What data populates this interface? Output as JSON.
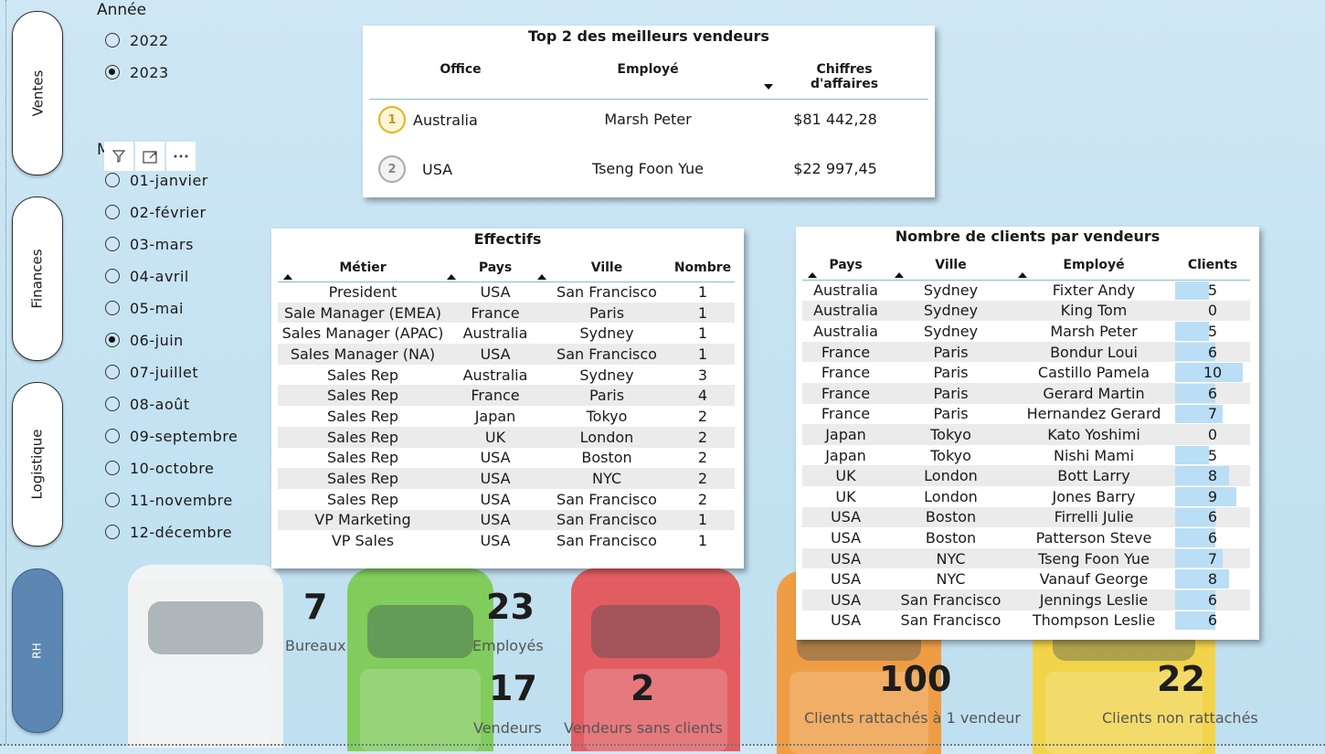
{
  "nav": {
    "items": [
      {
        "label": "Ventes"
      },
      {
        "label": "Finances"
      },
      {
        "label": "Logistique"
      },
      {
        "label": "RH"
      }
    ]
  },
  "slicer_annee": {
    "title": "Année",
    "options": [
      {
        "label": "2022",
        "selected": false
      },
      {
        "label": "2023",
        "selected": true
      }
    ]
  },
  "slicer_mois": {
    "title": "Mois",
    "options": [
      {
        "label": "01-janvier",
        "selected": false
      },
      {
        "label": "02-février",
        "selected": false
      },
      {
        "label": "03-mars",
        "selected": false
      },
      {
        "label": "04-avril",
        "selected": false
      },
      {
        "label": "05-mai",
        "selected": false
      },
      {
        "label": "06-juin",
        "selected": true
      },
      {
        "label": "07-juillet",
        "selected": false
      },
      {
        "label": "08-août",
        "selected": false
      },
      {
        "label": "09-septembre",
        "selected": false
      },
      {
        "label": "10-octobre",
        "selected": false
      },
      {
        "label": "11-novembre",
        "selected": false
      },
      {
        "label": "12-décembre",
        "selected": false
      }
    ],
    "tools": [
      "filter-icon",
      "focus-mode-icon",
      "more-options-icon"
    ]
  },
  "top_vendeurs": {
    "title": "Top 2 des meilleurs vendeurs",
    "headers": [
      "Office",
      "Employé",
      "Chiffres d'affaires"
    ],
    "rows": [
      {
        "rank": "1",
        "office": "Australia",
        "employe": "Marsh Peter",
        "ca": "$81 442,28"
      },
      {
        "rank": "2",
        "office": "USA",
        "employe": "Tseng Foon Yue",
        "ca": "$22 997,45"
      }
    ]
  },
  "effectifs": {
    "title": "Effectifs",
    "headers": [
      "Métier",
      "Pays",
      "Ville",
      "Nombre"
    ],
    "rows": [
      [
        "President",
        "USA",
        "San Francisco",
        "1"
      ],
      [
        "Sale Manager (EMEA)",
        "France",
        "Paris",
        "1"
      ],
      [
        "Sales Manager (APAC)",
        "Australia",
        "Sydney",
        "1"
      ],
      [
        "Sales Manager (NA)",
        "USA",
        "San Francisco",
        "1"
      ],
      [
        "Sales Rep",
        "Australia",
        "Sydney",
        "3"
      ],
      [
        "Sales Rep",
        "France",
        "Paris",
        "4"
      ],
      [
        "Sales Rep",
        "Japan",
        "Tokyo",
        "2"
      ],
      [
        "Sales Rep",
        "UK",
        "London",
        "2"
      ],
      [
        "Sales Rep",
        "USA",
        "Boston",
        "2"
      ],
      [
        "Sales Rep",
        "USA",
        "NYC",
        "2"
      ],
      [
        "Sales Rep",
        "USA",
        "San Francisco",
        "2"
      ],
      [
        "VP Marketing",
        "USA",
        "San Francisco",
        "1"
      ],
      [
        "VP Sales",
        "USA",
        "San Francisco",
        "1"
      ]
    ]
  },
  "clients_par_vendeur": {
    "title": "Nombre de clients par vendeurs",
    "headers": [
      "Pays",
      "Ville",
      "Employé",
      "Clients"
    ],
    "bar_max": 10,
    "bar_color": "#b9def5",
    "rows": [
      [
        "Australia",
        "Sydney",
        "Fixter Andy",
        5
      ],
      [
        "Australia",
        "Sydney",
        "King Tom",
        0
      ],
      [
        "Australia",
        "Sydney",
        "Marsh Peter",
        5
      ],
      [
        "France",
        "Paris",
        "Bondur Loui",
        6
      ],
      [
        "France",
        "Paris",
        "Castillo Pamela",
        10
      ],
      [
        "France",
        "Paris",
        "Gerard Martin",
        6
      ],
      [
        "France",
        "Paris",
        "Hernandez Gerard",
        7
      ],
      [
        "Japan",
        "Tokyo",
        "Kato Yoshimi",
        0
      ],
      [
        "Japan",
        "Tokyo",
        "Nishi Mami",
        5
      ],
      [
        "UK",
        "London",
        "Bott Larry",
        8
      ],
      [
        "UK",
        "London",
        "Jones Barry",
        9
      ],
      [
        "USA",
        "Boston",
        "Firrelli Julie",
        6
      ],
      [
        "USA",
        "Boston",
        "Patterson Steve",
        6
      ],
      [
        "USA",
        "NYC",
        "Tseng Foon Yue",
        7
      ],
      [
        "USA",
        "NYC",
        "Vanauf George",
        8
      ],
      [
        "USA",
        "San Francisco",
        "Jennings Leslie",
        6
      ],
      [
        "USA",
        "San Francisco",
        "Thompson Leslie",
        6
      ]
    ]
  },
  "kpis": {
    "bureaux": {
      "value": "7",
      "label": "Bureaux"
    },
    "employes": {
      "value": "23",
      "label": "Employés"
    },
    "vendeurs": {
      "value": "17",
      "label": "Vendeurs"
    },
    "vendeurs_sans_clients": {
      "value": "2",
      "label": "Vendeurs sans clients"
    },
    "clients_rattaches": {
      "value": "100",
      "label": "Clients rattachés à 1 vendeur"
    },
    "clients_non_rattaches": {
      "value": "22",
      "label": "Clients non rattachés"
    }
  },
  "colors": {
    "background": "#c4e2f2",
    "nav_active": "#5c87b3",
    "car_white": "#f4f4f4",
    "car_green": "#7ecb55",
    "car_red": "#e4565a",
    "car_orange": "#f29a3c",
    "car_yellow": "#f5d443"
  }
}
